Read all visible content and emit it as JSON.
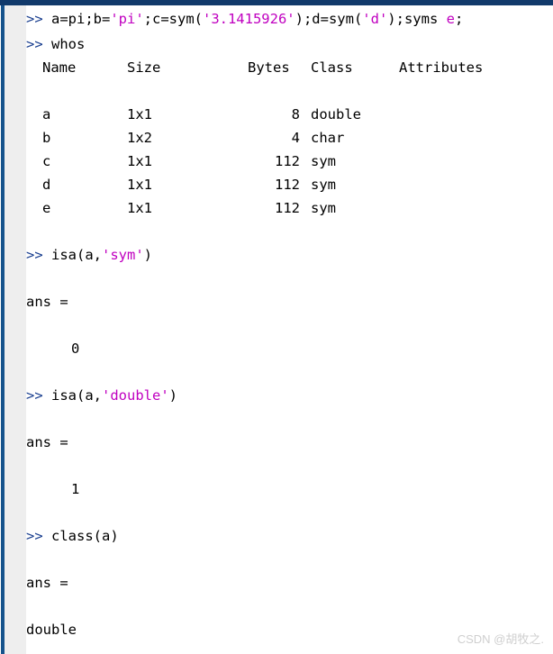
{
  "window": {
    "app": "MATLAB Command Window",
    "colors": {
      "background": "#ffffff",
      "gutter": "#eeeeee",
      "border_top": "#113a6b",
      "border_left": "#16538c",
      "prompt": "#1a3f8f",
      "text": "#000000",
      "string": "#c000c0",
      "watermark": "#cfcfcf"
    }
  },
  "transcript": {
    "prompt_symbol": ">>",
    "commands": {
      "declare": {
        "prompt": ">>",
        "seg1": " a=pi;b=",
        "str1": "'pi'",
        "seg2": ";c=sym(",
        "str2": "'3.1415926'",
        "seg3": ");d=sym(",
        "str3": "'d'",
        "seg4": ");syms ",
        "str4": "e",
        "seg5": ";"
      },
      "whos": {
        "prompt": ">>",
        "text": " whos"
      },
      "isa_sym": {
        "prompt": ">>",
        "seg1": " isa(a,",
        "str1": "'sym'",
        "seg2": ")"
      },
      "isa_double": {
        "prompt": ">>",
        "seg1": " isa(a,",
        "str1": "'double'",
        "seg2": ")"
      },
      "class_a": {
        "prompt": ">>",
        "text": " class(a)"
      }
    },
    "ans_label": "ans =",
    "results": {
      "isa_sym_value": "0",
      "isa_double_value": "1",
      "class_a_value": "double"
    }
  },
  "whos_table": {
    "headers": [
      "Name",
      "Size",
      "Bytes",
      "Class",
      "Attributes"
    ],
    "rows": [
      {
        "name": "a",
        "size": "1x1",
        "bytes": "8",
        "class": "double",
        "attributes": ""
      },
      {
        "name": "b",
        "size": "1x2",
        "bytes": "4",
        "class": "char",
        "attributes": ""
      },
      {
        "name": "c",
        "size": "1x1",
        "bytes": "112",
        "class": "sym",
        "attributes": ""
      },
      {
        "name": "d",
        "size": "1x1",
        "bytes": "112",
        "class": "sym",
        "attributes": ""
      },
      {
        "name": "e",
        "size": "1x1",
        "bytes": "112",
        "class": "sym",
        "attributes": ""
      }
    ]
  },
  "watermark": {
    "text": "CSDN @胡牧之."
  }
}
